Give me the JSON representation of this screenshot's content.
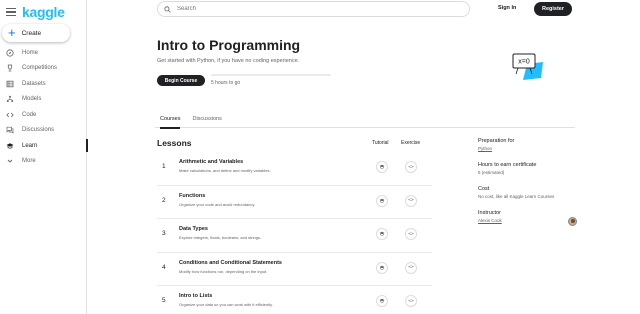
{
  "brand": {
    "logo": "kaggle"
  },
  "sidebar": {
    "create_label": "Create",
    "items": [
      {
        "label": "Home",
        "icon": "compass-icon"
      },
      {
        "label": "Competitions",
        "icon": "trophy-icon"
      },
      {
        "label": "Datasets",
        "icon": "table-icon"
      },
      {
        "label": "Models",
        "icon": "models-icon"
      },
      {
        "label": "Code",
        "icon": "code-icon"
      },
      {
        "label": "Discussions",
        "icon": "comments-icon"
      },
      {
        "label": "Learn",
        "icon": "school-icon",
        "active": true
      },
      {
        "label": "More",
        "icon": "expand-more-icon"
      }
    ]
  },
  "header": {
    "search_placeholder": "Search",
    "signin_label": "Sign In",
    "register_label": "Register"
  },
  "course": {
    "title": "Intro to Programming",
    "subtitle": "Get started with Python, if you have no coding experience.",
    "begin_label": "Begin Course",
    "progress": 0,
    "hours_text": "5 hours to go"
  },
  "tabs": [
    {
      "label": "Courses",
      "active": true
    },
    {
      "label": "Discussions",
      "active": false
    }
  ],
  "lessons_section": {
    "title": "Lessons",
    "tutorial_header": "Tutorial",
    "exercise_header": "Exercise",
    "lessons": [
      {
        "num": "1",
        "title": "Arithmetic and Variables",
        "desc": "Make calculations, and define and modify variables."
      },
      {
        "num": "2",
        "title": "Functions",
        "desc": "Organize your code and avoid redundancy."
      },
      {
        "num": "3",
        "title": "Data Types",
        "desc": "Explore integers, floats, booleans, and strings."
      },
      {
        "num": "4",
        "title": "Conditions and Conditional Statements",
        "desc": "Modify how functions run, depending on the input."
      },
      {
        "num": "5",
        "title": "Intro to Lists",
        "desc": "Organize your data so you can work with it efficiently."
      }
    ]
  },
  "info": {
    "prep_label": "Preparation for",
    "prep_value": "Python",
    "hours_label": "Hours to earn certificate",
    "hours_value": "5 (estimated)",
    "cost_label": "Cost",
    "cost_value": "No cost, like all Kaggle Learn Courses",
    "instructor_label": "Instructor",
    "instructor_value": "Alexis Cook"
  },
  "colors": {
    "brand": "#20beff",
    "dark": "#202124",
    "illustration": "#20beff"
  }
}
